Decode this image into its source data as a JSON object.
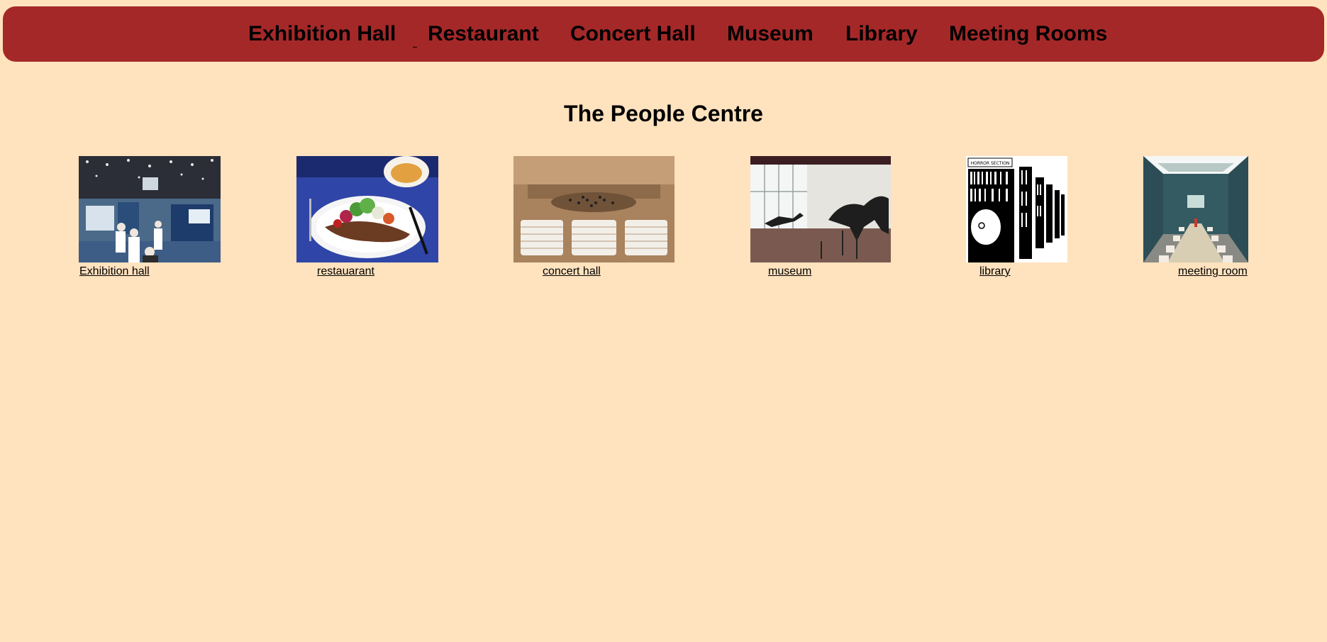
{
  "nav": {
    "items": [
      {
        "label": "Exhibition Hall"
      },
      {
        "label": "Restaurant"
      },
      {
        "label": "Concert Hall"
      },
      {
        "label": "Museum"
      },
      {
        "label": "Library"
      },
      {
        "label": "Meeting Rooms"
      }
    ]
  },
  "page": {
    "title": "The People Centre"
  },
  "gallery": {
    "items": [
      {
        "caption": "Exhibition hall",
        "image": "exhibition-hall-photo"
      },
      {
        "caption": "restauarant",
        "image": "restaurant-food-photo"
      },
      {
        "caption": "concert hall",
        "image": "concert-hall-photo"
      },
      {
        "caption": "museum",
        "image": "museum-dinosaur-photo"
      },
      {
        "caption": "library",
        "image": "library-horror-section-illustration"
      },
      {
        "caption": "meeting room",
        "image": "meeting-room-photo"
      }
    ]
  },
  "colors": {
    "background": "#FFE2BE",
    "navbar": "#A52828",
    "text": "#000000"
  }
}
